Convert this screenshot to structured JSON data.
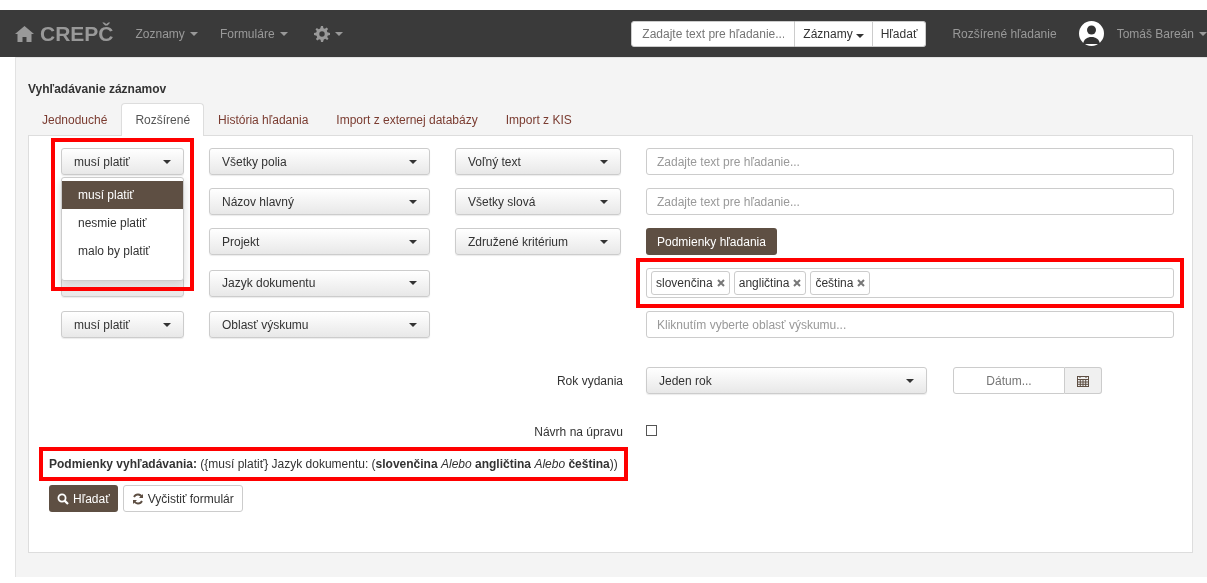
{
  "navbar": {
    "brand": "CREPČ",
    "menus": [
      {
        "label": "Zoznamy"
      },
      {
        "label": "Formuláre"
      }
    ],
    "search": {
      "placeholder": "Zadajte text pre hľadanie...",
      "scope": "Záznamy",
      "button": "Hľadať"
    },
    "advanced_link": "Rozšírené hľadanie",
    "user": "Tomáš Bareán"
  },
  "page_title": "Vyhľadávanie záznamov",
  "tabs": [
    {
      "label": "Jednoduché",
      "selected": false
    },
    {
      "label": "Rozšírené",
      "selected": true
    },
    {
      "label": "História hľadania",
      "selected": false
    },
    {
      "label": "Import z externej databázy",
      "selected": false
    },
    {
      "label": "Import z KIS",
      "selected": false
    }
  ],
  "criteria": [
    {
      "operator": "musí platiť",
      "field": "Všetky polia",
      "mode": "Voľný text",
      "value": {
        "kind": "text",
        "placeholder": "Zadajte text pre hľadanie..."
      }
    },
    {
      "field": "Názov hlavný",
      "mode": "Všetky slová",
      "value": {
        "kind": "text",
        "placeholder": "Zadajte text pre hľadanie..."
      }
    },
    {
      "field": "Projekt",
      "mode": "Združené kritérium",
      "value": {
        "kind": "button",
        "label": "Podmienky hľadania"
      }
    },
    {
      "field": "Jazyk dokumentu",
      "value": {
        "kind": "tags",
        "highlighted": true,
        "tags": [
          "slovenčina",
          "angličtina",
          "čeština"
        ]
      }
    },
    {
      "operator": "musí platiť",
      "field": "Oblasť výskumu",
      "value": {
        "kind": "picker",
        "placeholder": "Kliknutím vyberte oblasť výskumu..."
      }
    }
  ],
  "operator_menu": {
    "open": true,
    "highlighted": true,
    "items": [
      {
        "label": "musí platiť",
        "selected": true
      },
      {
        "label": "nesmie platiť",
        "selected": false
      },
      {
        "label": "malo by platiť",
        "selected": false
      }
    ]
  },
  "year": {
    "label": "Rok vydania",
    "select": "Jeden rok",
    "date_placeholder": "Dátum..."
  },
  "proposal": {
    "label": "Návrh na úpravu",
    "checked": false
  },
  "summary": {
    "text": "**Podmienky vyhľadávania:** ({musí platiť} Jazyk dokumentu: (**slovenčina** *Alebo* **angličtina** *Alebo* **čeština**))",
    "highlighted": true
  },
  "buttons": [
    {
      "label": "Hľadať",
      "kind": "primary"
    },
    {
      "label": "Vyčistiť formulár",
      "kind": "default"
    }
  ]
}
